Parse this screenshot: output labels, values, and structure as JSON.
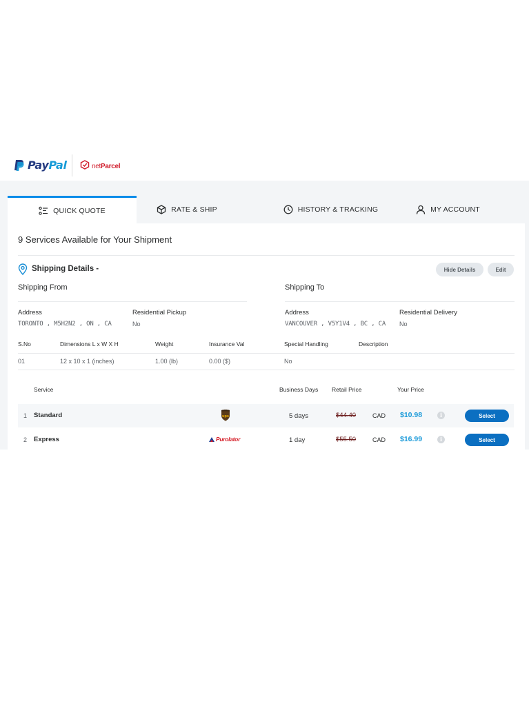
{
  "brand": {
    "paypal_pay": "Pay",
    "paypal_pal": "Pal",
    "netparcel_net": "net",
    "netparcel_parcel": "Parcel"
  },
  "tabs": [
    {
      "label": "QUICK QUOTE",
      "icon": "list-icon",
      "active": true
    },
    {
      "label": "RATE & SHIP",
      "icon": "box-icon",
      "active": false
    },
    {
      "label": "HISTORY & TRACKING",
      "icon": "clock-icon",
      "active": false
    },
    {
      "label": "MY ACCOUNT",
      "icon": "user-icon",
      "active": false
    }
  ],
  "main": {
    "title": "9 Services Available for Your Shipment"
  },
  "details": {
    "title": "Shipping Details -",
    "hide_label": "Hide Details",
    "edit_label": "Edit",
    "from": {
      "heading": "Shipping From",
      "address_label": "Address",
      "address_value": "TORONTO , M5H2N2 , ON , CA",
      "residential_label": "Residential Pickup",
      "residential_value": "No"
    },
    "to": {
      "heading": "Shipping To",
      "address_label": "Address",
      "address_value": "VANCOUVER , V5Y1V4 , BC , CA",
      "residential_label": "Residential Delivery",
      "residential_value": "No"
    },
    "package_headers": [
      "S.No",
      "Dimensions L x W X H",
      "Weight",
      "Insurance Val",
      "Special Handling",
      "Description"
    ],
    "package_row": [
      "01",
      "12 x 10 x 1  (inches)",
      "1.00  (lb)",
      "0.00  ($)",
      "No",
      ""
    ]
  },
  "services": {
    "headers": {
      "service": "Service",
      "days": "Business Days",
      "retail": "Retail Price",
      "yours": "Your Price"
    },
    "rows": [
      {
        "num": "1",
        "name": "Standard",
        "carrier": "ups-logo",
        "days": "5 days",
        "retail": "$44.40",
        "currency": "CAD",
        "price": "$10.98",
        "button": "Select"
      },
      {
        "num": "2",
        "name": "Express",
        "carrier": "purolator-logo",
        "carrier_text": "Purolator",
        "days": "1 day",
        "retail": "$55.50",
        "currency": "CAD",
        "price": "$16.99",
        "button": "Select"
      }
    ]
  },
  "colors": {
    "accent": "#0c8ce9",
    "button": "#0b6fc1",
    "price": "#1a9ad9",
    "paypal_dark": "#253b80",
    "paypal_light": "#179bd7",
    "netparcel_red": "#d1202f"
  }
}
